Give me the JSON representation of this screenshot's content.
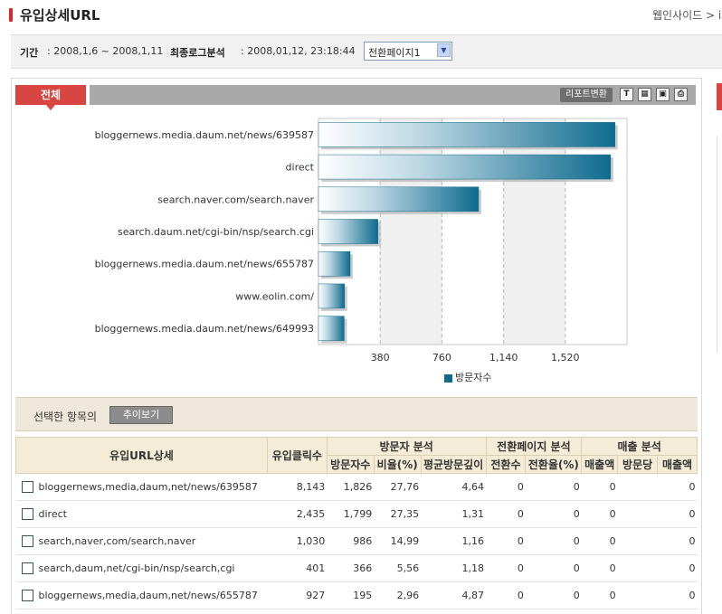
{
  "header": {
    "title": "유입상세URL",
    "crumb": "웹인사이드 > i"
  },
  "period": {
    "label": "기간",
    "value": ": 2008,1,6 ~ 2008,1,11",
    "last_label": "최종로그분석",
    "last_value": ": 2008,01,12, 23:18:44",
    "select_value": "전환페이지1"
  },
  "toolbar": {
    "tab_all": "전체",
    "report_label": "리포트변환",
    "icons": [
      "text-icon",
      "excel-icon",
      "image-icon",
      "print-icon"
    ],
    "icon_text": "T"
  },
  "chart_data": {
    "type": "bar",
    "orientation": "horizontal",
    "categories": [
      "bloggernews.media.daum.net/news/639587",
      "direct",
      "search.naver.com/search.naver",
      "search.daum.net/cgi-bin/nsp/search.cgi",
      "bloggernews.media.daum.net/news/655787",
      "www.eolin.com/",
      "bloggernews.media.daum.net/news/649993"
    ],
    "values": [
      1826,
      1799,
      986,
      366,
      195,
      160,
      158
    ],
    "series": [
      {
        "name": "방문자수",
        "values": [
          1826,
          1799,
          986,
          366,
          195,
          160,
          158
        ]
      }
    ],
    "xticks": [
      "380",
      "760",
      "1,140",
      "1,520"
    ],
    "xtick_values": [
      380,
      760,
      1140,
      1520
    ],
    "xlim": [
      0,
      1900
    ],
    "bar_color": "#0e6b8e",
    "legend_position": "bottom"
  },
  "selection": {
    "label": "선택한 항목의",
    "trend_button": "추이보기"
  },
  "table": {
    "headers": {
      "url": "유입URL상세",
      "clicks": "유입클릭수",
      "visitor_group": "방문자 분석",
      "conversion_group": "전환페이지 분석",
      "sales_group": "매출 분석",
      "visitors": "방문자수",
      "ratio": "비율(%)",
      "depth": "평균방문깊이",
      "conv_count": "전환수",
      "conv_rate": "전환율(%)",
      "sales": "매출액",
      "per_visit": "방문당",
      "sales2": "매출액"
    },
    "rows": [
      {
        "url": "bloggernews,media,daum,net/news/639587",
        "clicks": "8,143",
        "visitors": "1,826",
        "ratio": "27,76",
        "depth": "4,64",
        "conv": "0",
        "rate": "0",
        "sales": "0",
        "per_visit": "",
        "sales2": "0"
      },
      {
        "url": "direct",
        "clicks": "2,435",
        "visitors": "1,799",
        "ratio": "27,35",
        "depth": "1,31",
        "conv": "0",
        "rate": "0",
        "sales": "0",
        "per_visit": "",
        "sales2": "0"
      },
      {
        "url": "search,naver,com/search,naver",
        "clicks": "1,030",
        "visitors": "986",
        "ratio": "14,99",
        "depth": "1,16",
        "conv": "0",
        "rate": "0",
        "sales": "0",
        "per_visit": "",
        "sales2": "0"
      },
      {
        "url": "search,daum,net/cgi-bin/nsp/search,cgi",
        "clicks": "401",
        "visitors": "366",
        "ratio": "5,56",
        "depth": "1,18",
        "conv": "0",
        "rate": "0",
        "sales": "0",
        "per_visit": "",
        "sales2": "0"
      },
      {
        "url": "bloggernews,media,daum,net/news/655787",
        "clicks": "927",
        "visitors": "195",
        "ratio": "2,96",
        "depth": "4,87",
        "conv": "0",
        "rate": "0",
        "sales": "0",
        "per_visit": "",
        "sales2": "0"
      }
    ]
  }
}
